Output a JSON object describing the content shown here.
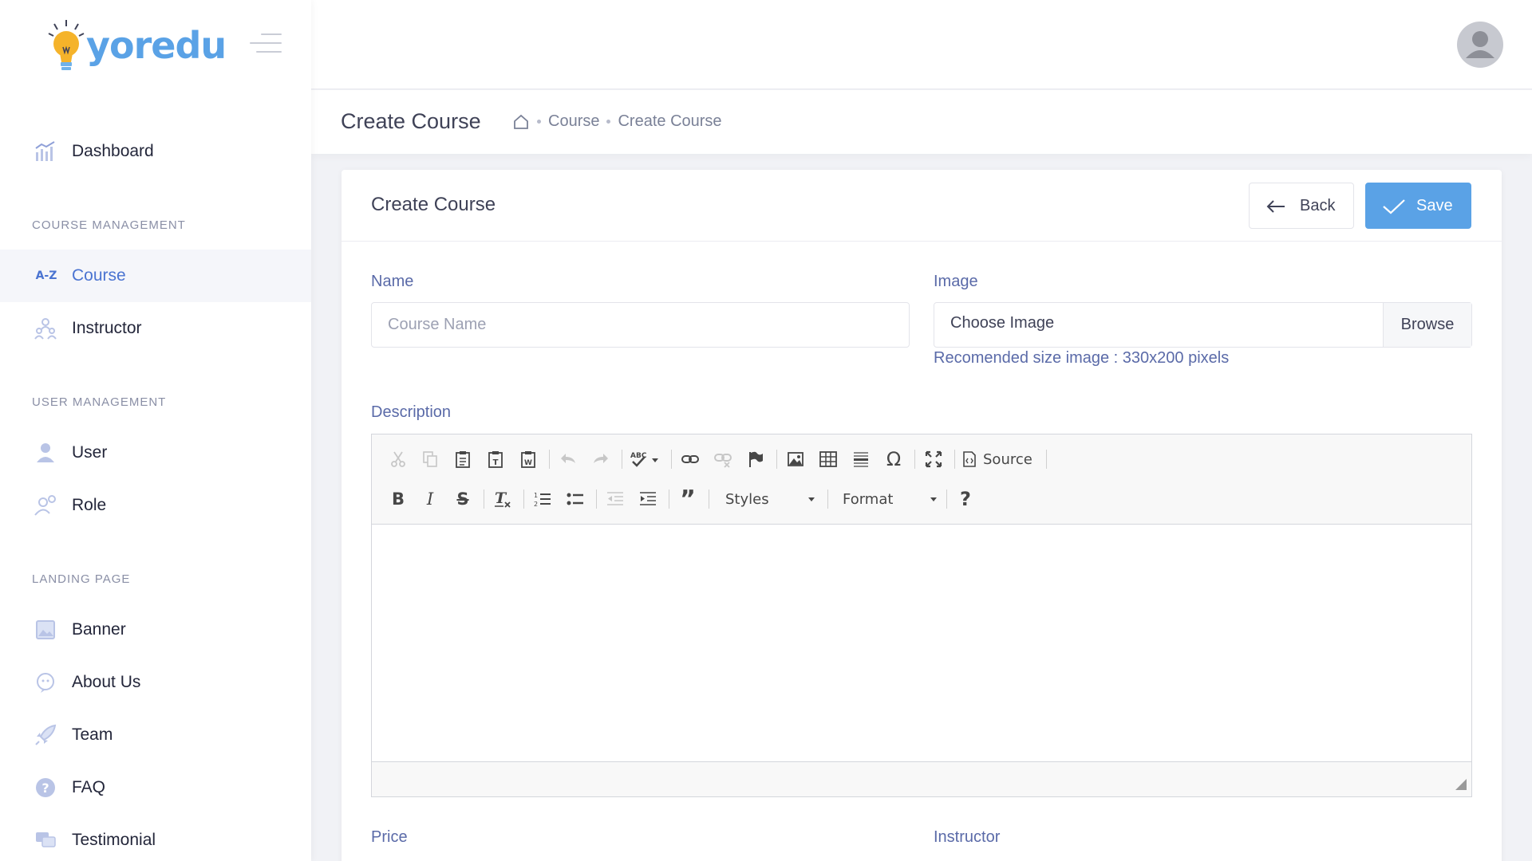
{
  "app": {
    "logo_text": "yoredu"
  },
  "sidebar": {
    "dashboard": "Dashboard",
    "sections": [
      {
        "title": "COURSE MANAGEMENT",
        "items": [
          {
            "label": "Course",
            "icon": "az-icon",
            "active": true
          },
          {
            "label": "Instructor",
            "icon": "users-icon"
          }
        ]
      },
      {
        "title": "USER MANAGEMENT",
        "items": [
          {
            "label": "User",
            "icon": "user-icon"
          },
          {
            "label": "Role",
            "icon": "user-gear-icon"
          }
        ]
      },
      {
        "title": "LANDING PAGE",
        "items": [
          {
            "label": "Banner",
            "icon": "banner-icon"
          },
          {
            "label": "About Us",
            "icon": "chat-icon"
          },
          {
            "label": "Team",
            "icon": "rocket-icon"
          },
          {
            "label": "FAQ",
            "icon": "question-icon"
          },
          {
            "label": "Testimonial",
            "icon": "comments-icon"
          }
        ]
      }
    ]
  },
  "header": {
    "avatar_icon": "avatar-icon"
  },
  "subheader": {
    "title": "Create Course",
    "breadcrumb": [
      "Course",
      "Create Course"
    ]
  },
  "card": {
    "title": "Create Course",
    "back_label": "Back",
    "save_label": "Save",
    "accent_color": "#5aa2e6"
  },
  "form": {
    "name_label": "Name",
    "name_placeholder": "Course Name",
    "name_value": "",
    "image_label": "Image",
    "image_text": "Choose Image",
    "image_browse": "Browse",
    "image_hint": "Recomended size image : 330x200 pixels",
    "description_label": "Description",
    "price_label": "Price",
    "instructor_label": "Instructor"
  },
  "editor": {
    "source_label": "Source",
    "styles_label": "Styles",
    "format_label": "Format",
    "content": ""
  }
}
